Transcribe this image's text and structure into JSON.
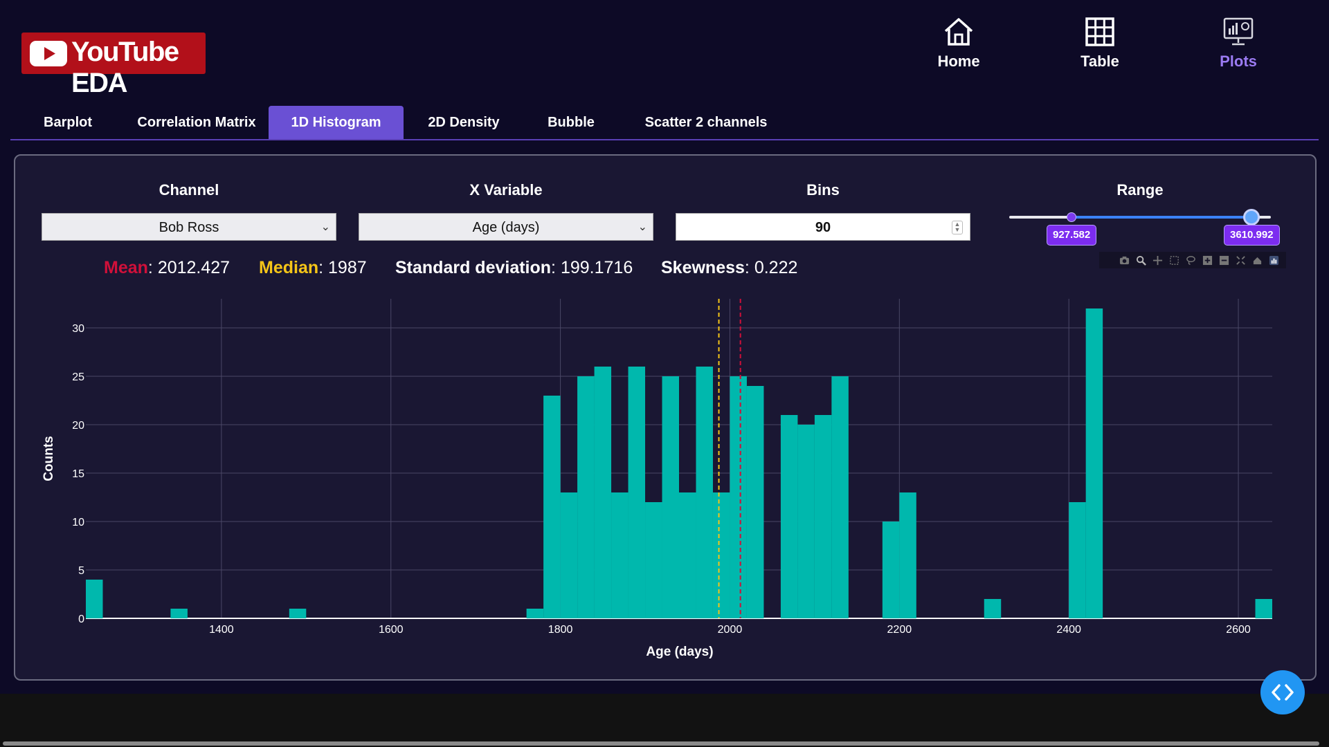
{
  "app": {
    "title": "YouTube EDA"
  },
  "nav": [
    {
      "id": "home",
      "label": "Home",
      "icon": "home-icon",
      "active": false
    },
    {
      "id": "table",
      "label": "Table",
      "icon": "table-icon",
      "active": false
    },
    {
      "id": "plots",
      "label": "Plots",
      "icon": "plots-icon",
      "active": true
    }
  ],
  "tabs": [
    {
      "label": "Barplot",
      "active": false
    },
    {
      "label": "Correlation Matrix",
      "active": false
    },
    {
      "label": "1D Histogram",
      "active": true
    },
    {
      "label": "2D Density",
      "active": false
    },
    {
      "label": "Bubble",
      "active": false
    },
    {
      "label": "Scatter 2 channels",
      "active": false
    }
  ],
  "controls": {
    "channel_label": "Channel",
    "channel_value": "Bob Ross",
    "xvar_label": "X Variable",
    "xvar_value": "Age (days)",
    "bins_label": "Bins",
    "bins_value": "90",
    "range_label": "Range",
    "range_min": "927.582",
    "range_max": "3610.992"
  },
  "stats": {
    "mean_label": "Mean",
    "mean_value": "2012.427",
    "median_label": "Median",
    "median_value": "1987",
    "std_label": "Standard deviation",
    "std_value": "199.1716",
    "skew_label": "Skewness",
    "skew_value": "0.222"
  },
  "colors": {
    "background": "#0d0a26",
    "panel": "#1a1733",
    "accent": "#6a50d4",
    "bar": "#00b8ad",
    "mean": "#d0103a",
    "median": "#f5c518",
    "logo": "#b2101a"
  },
  "modebar_icons": [
    "camera-icon",
    "zoom-icon",
    "pan-icon",
    "box-select-icon",
    "lasso-icon",
    "zoom-in-icon",
    "zoom-out-icon",
    "autoscale-icon",
    "reset-axes-icon",
    "plotly-logo-icon"
  ],
  "chart_data": {
    "type": "bar",
    "title": "",
    "xlabel": "Age (days)",
    "ylabel": "Counts",
    "xlim": [
      1240,
      2640
    ],
    "ylim": [
      0,
      33
    ],
    "xticks": [
      1400,
      1600,
      1800,
      2000,
      2200,
      2400,
      2600
    ],
    "yticks": [
      0,
      5,
      10,
      15,
      20,
      25,
      30
    ],
    "bin_width": 20,
    "bins": [
      {
        "x0": 1240,
        "value": 4
      },
      {
        "x0": 1340,
        "value": 1
      },
      {
        "x0": 1480,
        "value": 1
      },
      {
        "x0": 1760,
        "value": 1
      },
      {
        "x0": 1780,
        "value": 23
      },
      {
        "x0": 1800,
        "value": 13
      },
      {
        "x0": 1820,
        "value": 25
      },
      {
        "x0": 1840,
        "value": 26
      },
      {
        "x0": 1860,
        "value": 13
      },
      {
        "x0": 1880,
        "value": 26
      },
      {
        "x0": 1900,
        "value": 12
      },
      {
        "x0": 1920,
        "value": 25
      },
      {
        "x0": 1940,
        "value": 13
      },
      {
        "x0": 1960,
        "value": 26
      },
      {
        "x0": 1980,
        "value": 13
      },
      {
        "x0": 2000,
        "value": 25
      },
      {
        "x0": 2020,
        "value": 24
      },
      {
        "x0": 2060,
        "value": 21
      },
      {
        "x0": 2080,
        "value": 20
      },
      {
        "x0": 2100,
        "value": 21
      },
      {
        "x0": 2120,
        "value": 25
      },
      {
        "x0": 2180,
        "value": 10
      },
      {
        "x0": 2200,
        "value": 13
      },
      {
        "x0": 2300,
        "value": 2
      },
      {
        "x0": 2400,
        "value": 12
      },
      {
        "x0": 2420,
        "value": 32
      },
      {
        "x0": 2620,
        "value": 2
      }
    ],
    "mean": 2012.427,
    "median": 1987,
    "grid": true
  }
}
